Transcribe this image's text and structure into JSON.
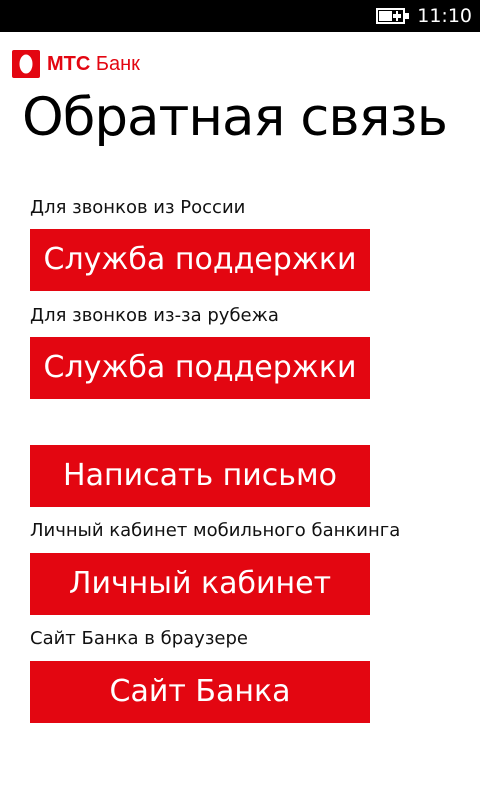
{
  "status_bar": {
    "time": "11:10",
    "battery_icon": "battery-charging-icon"
  },
  "brand": {
    "logo_icon": "mts-egg-logo-icon",
    "name_bold": "МТС",
    "name_regular": " Банк",
    "color": "#e30611"
  },
  "page": {
    "title": "Обратная связь"
  },
  "sections": {
    "russia_label": "Для звонков из России",
    "russia_button": "Служба поддержки",
    "abroad_label": "Для звонков из-за рубежа",
    "abroad_button": "Служба поддержки",
    "mail_button": "Написать письмо",
    "cabinet_label": "Личный кабинет мобильного банкинга",
    "cabinet_button": "Личный кабинет",
    "site_label": "Сайт Банка в браузере",
    "site_button": "Сайт Банка"
  },
  "colors": {
    "button_background": "#e30611",
    "button_text": "#ffffff",
    "page_background": "#ffffff",
    "status_bar": "#000000"
  }
}
